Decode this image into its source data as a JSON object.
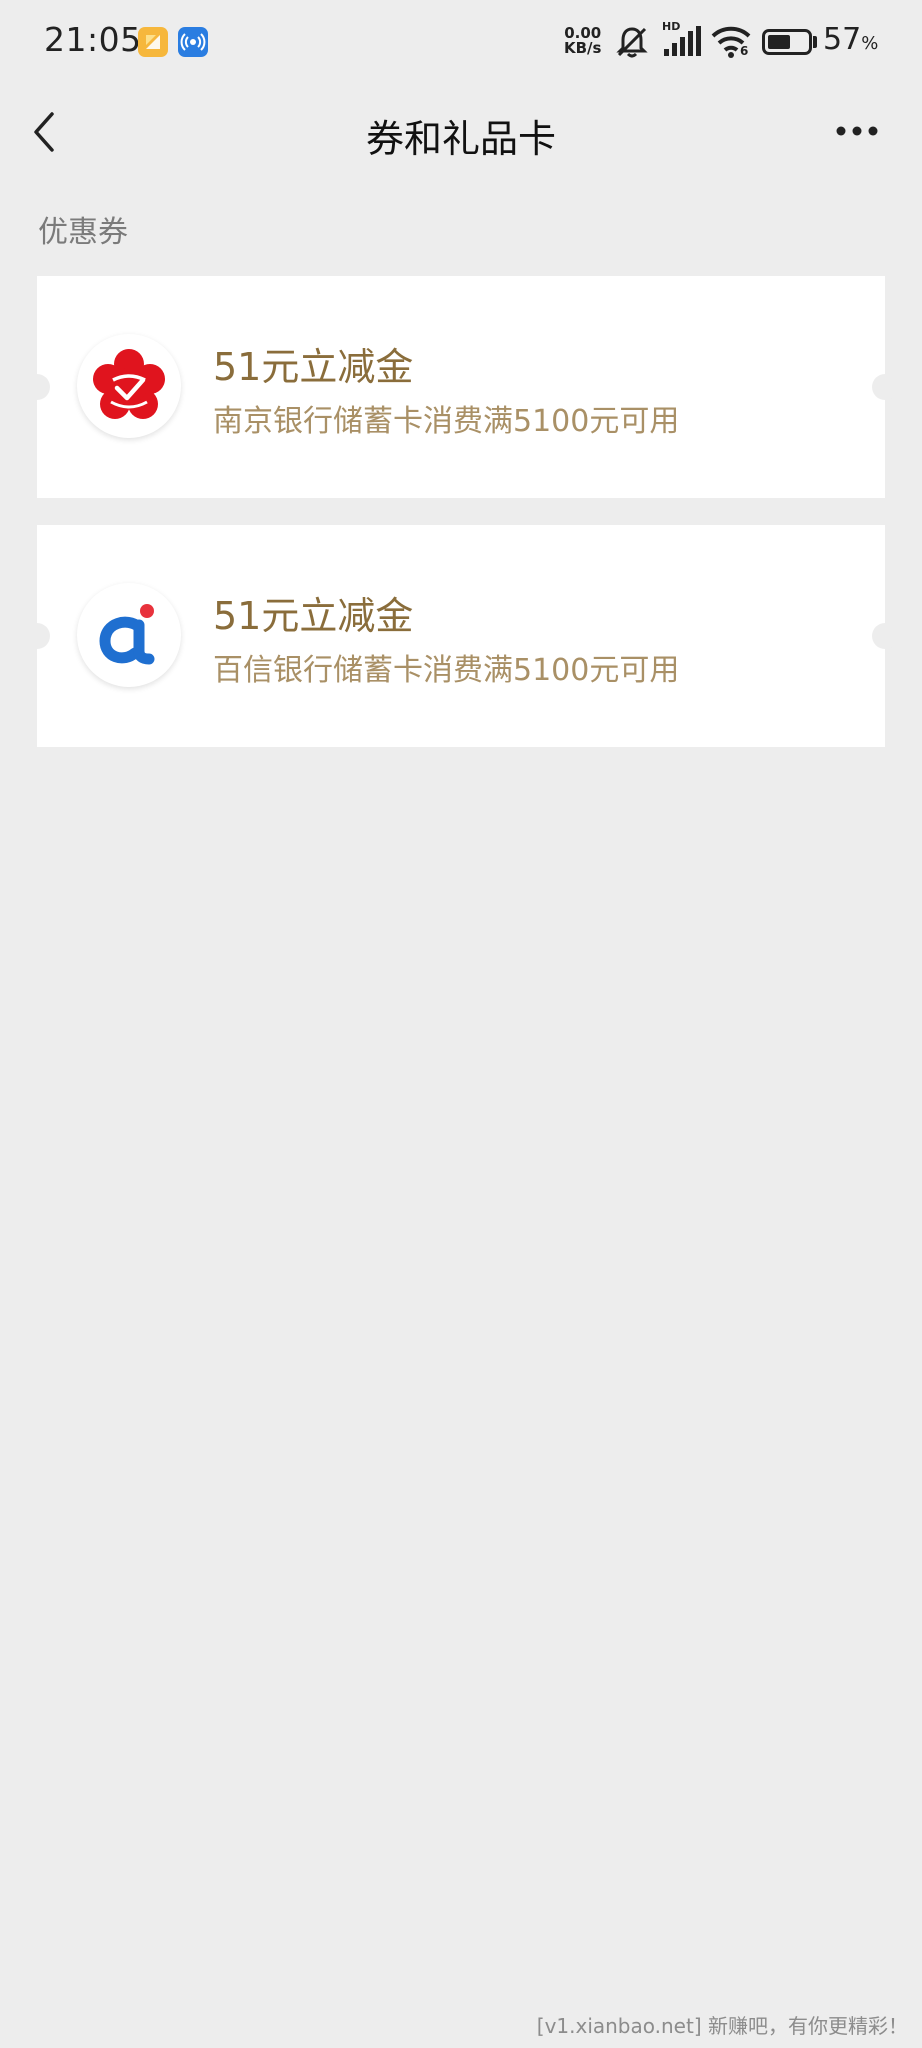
{
  "status_bar": {
    "time": "21:05",
    "net_speed_value": "0.00",
    "net_speed_unit": "KB/s",
    "signal_label": "HD",
    "wifi_label": "6",
    "battery_percent": "57",
    "battery_percent_sign": "%",
    "battery_level": 0.57,
    "icons": [
      "gallery-notification-icon",
      "nfc-notification-icon",
      "mute-bell-icon",
      "signal-icon",
      "wifi-icon",
      "battery-icon"
    ]
  },
  "nav": {
    "title": "券和礼品卡",
    "back_icon": "chevron-left-icon",
    "more_icon": "more-dots-icon"
  },
  "section": {
    "title": "优惠券"
  },
  "coupons": [
    {
      "title": "51元立减金",
      "description": "南京银行储蓄卡消费满5100元可用",
      "logo_icon": "bank-of-nanjing-logo-icon"
    },
    {
      "title": "51元立减金",
      "description": "百信银行储蓄卡消费满5100元可用",
      "logo_icon": "aibank-logo-icon"
    }
  ],
  "watermark": "[v1.xianbao.net] 新赚吧，有你更精彩！",
  "colors": {
    "background": "#ededed",
    "card": "#ffffff",
    "coupon_title": "#8a6d3b",
    "coupon_desc": "#a99066",
    "nanjing_red": "#e0141e",
    "aibank_blue": "#1f6fd0",
    "aibank_red": "#e8323c"
  }
}
